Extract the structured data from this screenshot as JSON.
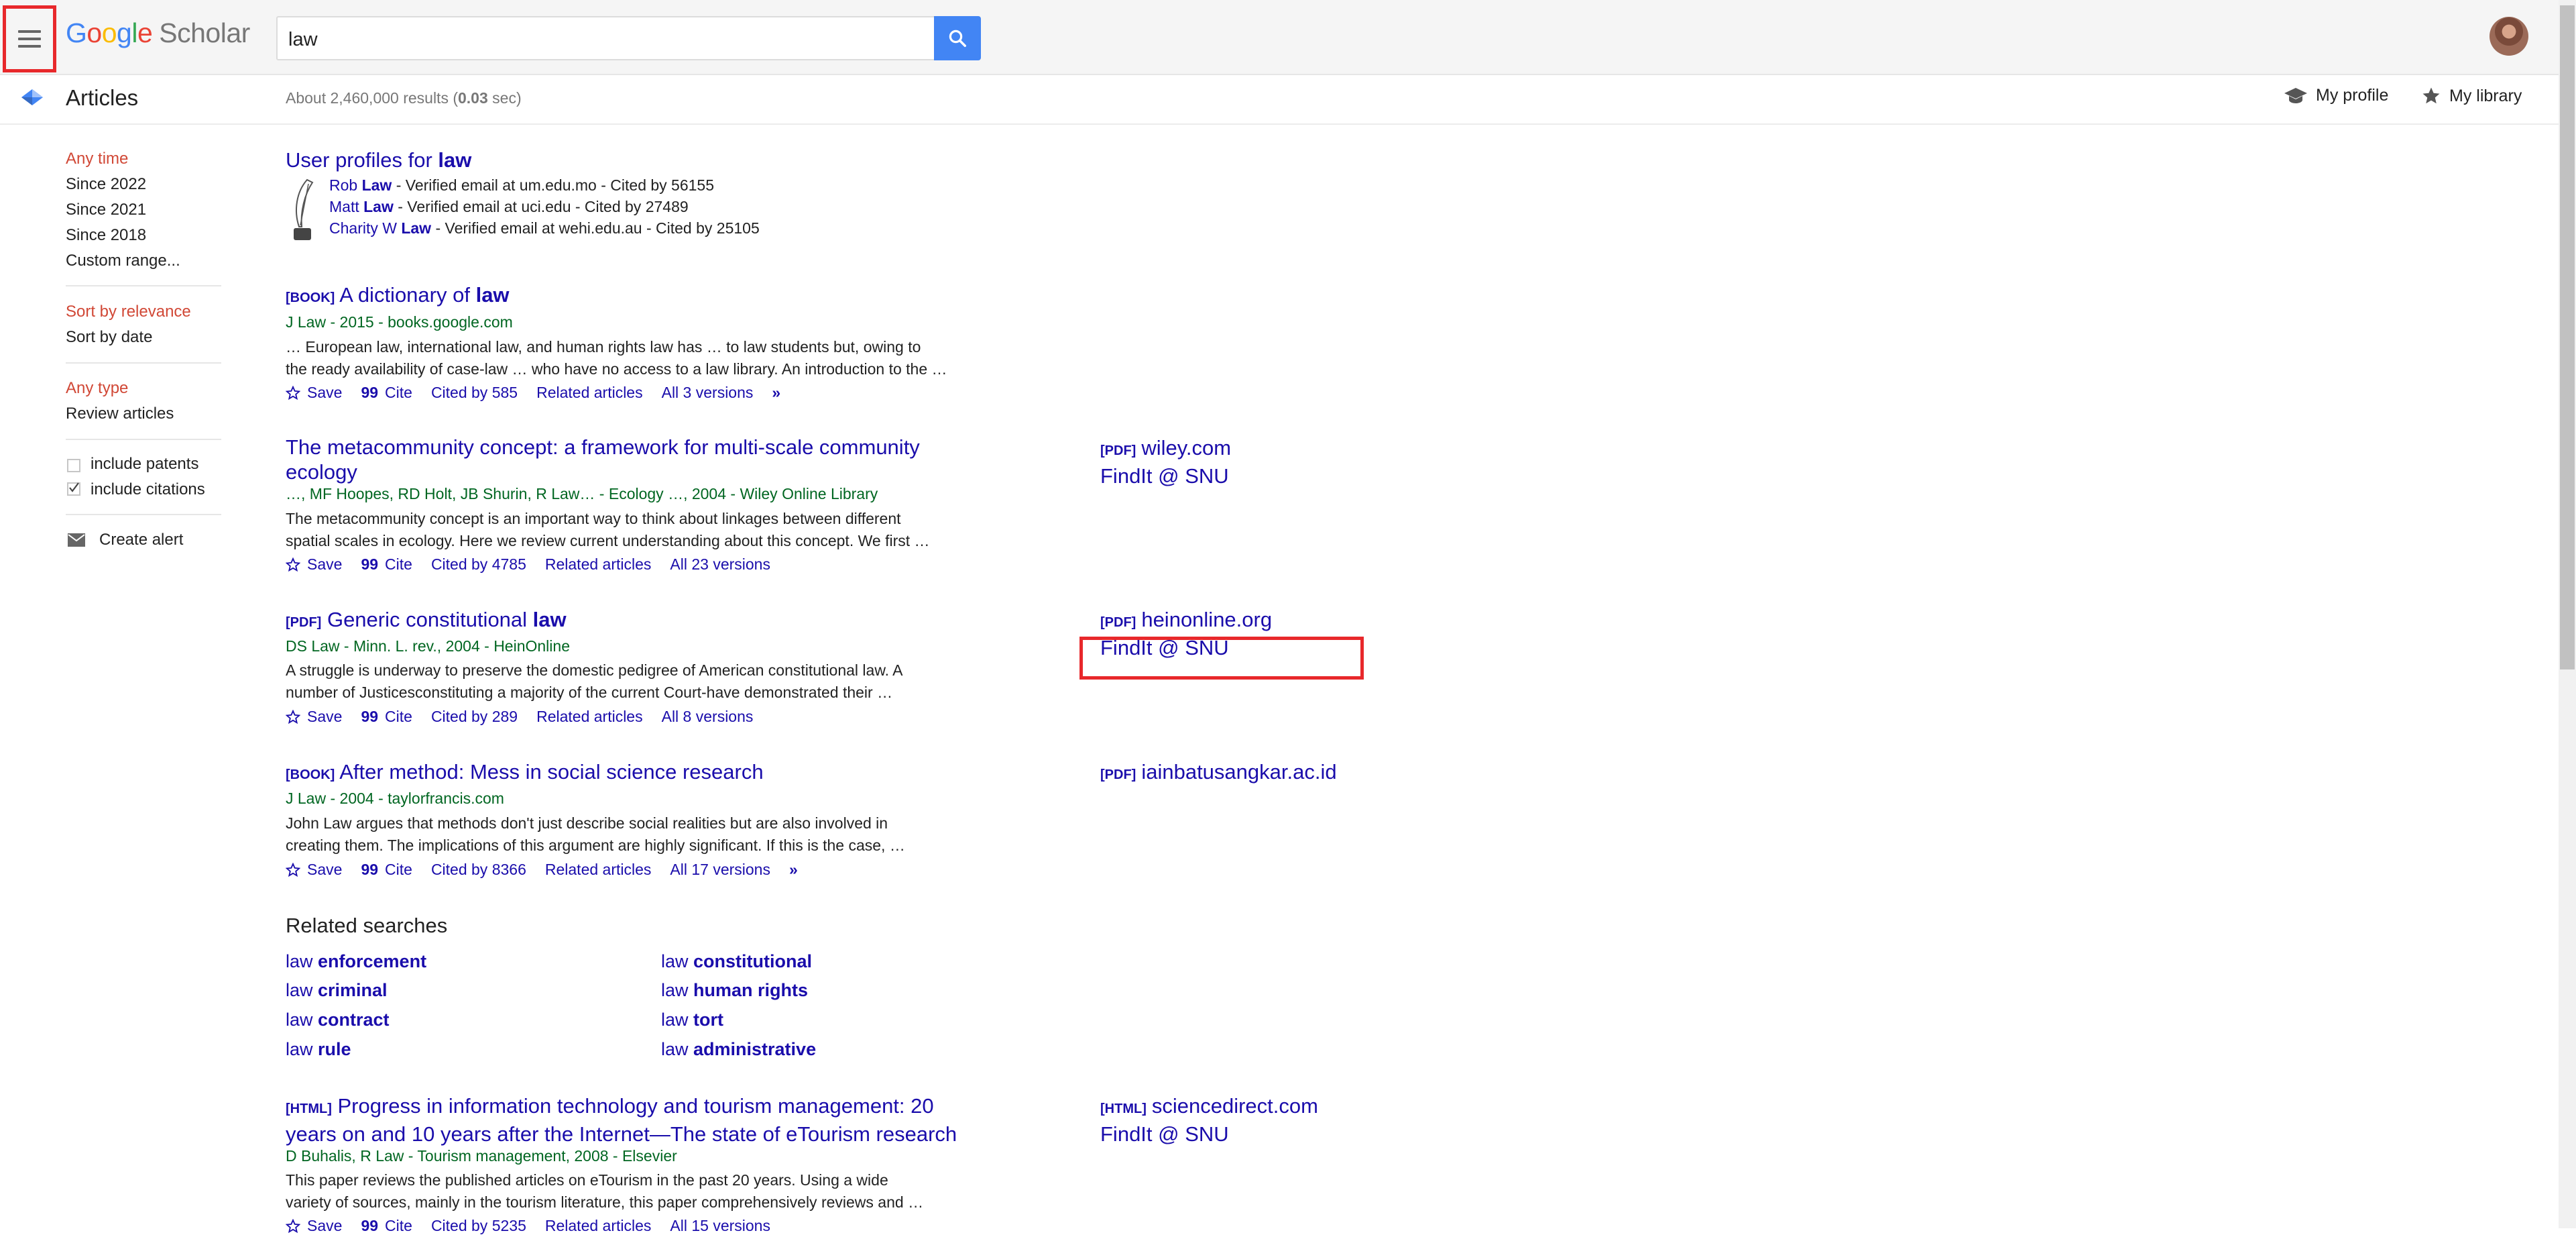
{
  "header": {
    "logo_google": [
      "G",
      "o",
      "o",
      "g",
      "l",
      "e"
    ],
    "logo_scholar": "Scholar",
    "search_value": "law"
  },
  "subheader": {
    "section_label": "Articles",
    "results_prefix": "About 2,460,000 results (",
    "results_time": "0.03",
    "results_suffix": " sec)",
    "my_profile": "My profile",
    "my_library": "My library"
  },
  "sidebar": {
    "time": [
      "Any time",
      "Since 2022",
      "Since 2021",
      "Since 2018",
      "Custom range..."
    ],
    "sort": [
      "Sort by relevance",
      "Sort by date"
    ],
    "type": [
      "Any type",
      "Review articles"
    ],
    "include_patents": "include patents",
    "include_citations": "include citations",
    "create_alert": "Create alert"
  },
  "user_profiles": {
    "title_prefix": "User profiles for ",
    "title_term": "law",
    "profiles": [
      {
        "first": "Rob ",
        "last": "Law",
        "rest": " - Verified email at um.edu.mo - Cited by 56155"
      },
      {
        "first": "Matt ",
        "last": "Law",
        "rest": " - Verified email at uci.edu - Cited by 27489"
      },
      {
        "first": "Charity W ",
        "last": "Law",
        "rest": " - Verified email at wehi.edu.au - Cited by 25105"
      }
    ]
  },
  "results": [
    {
      "tag": "[BOOK]",
      "title_a": "A dictionary of ",
      "title_b": "law",
      "meta": "J Law - 2015 - books.google.com",
      "snippet_1": "… European law, international law, and human rights law has … to law students but, owing to",
      "snippet_2": "the ready availability of case-law … who have no access to a law library. An introduction to the …",
      "save": "Save",
      "cite": "Cite",
      "cited": "Cited by 585",
      "related": "Related articles",
      "versions": "All 3 versions"
    },
    {
      "title_1": "The metacommunity concept: a framework for multi-scale community",
      "title_2": "ecology",
      "meta": "…, MF Hoopes, RD Holt, JB Shurin, R Law… - Ecology …, 2004 - Wiley Online Library",
      "snippet_1": "The metacommunity concept is an important way to think about linkages between different",
      "snippet_2": "spatial scales in ecology. Here we review current understanding about this concept. We first …",
      "save": "Save",
      "cite": "Cite",
      "cited": "Cited by 4785",
      "related": "Related articles",
      "versions": "All 23 versions",
      "side_tag": "[PDF]",
      "side_source": "wiley.com",
      "side_findit": "FindIt @ SNU"
    },
    {
      "tag": "[PDF]",
      "title_a": "Generic constitutional ",
      "title_b": "law",
      "meta": "DS Law - Minn. L. rev., 2004 - HeinOnline",
      "snippet_1": "A struggle is underway to preserve the domestic pedigree of American constitutional law. A",
      "snippet_2": "number of Justicesconstituting a majority of the current Court-have demonstrated their …",
      "save": "Save",
      "cite": "Cite",
      "cited": "Cited by 289",
      "related": "Related articles",
      "versions": "All 8 versions",
      "side_tag": "[PDF]",
      "side_source": "heinonline.org",
      "side_findit": "FindIt @ SNU"
    },
    {
      "tag": "[BOOK]",
      "title": "After method: Mess in social science research",
      "meta": "J Law - 2004 - taylorfrancis.com",
      "snippet_1": "John Law argues that methods don't just describe social realities but are also involved in",
      "snippet_2": "creating them. The implications of this argument are highly significant. If this is the case, …",
      "save": "Save",
      "cite": "Cite",
      "cited": "Cited by 8366",
      "related": "Related articles",
      "versions": "All 17 versions",
      "side_tag": "[PDF]",
      "side_source": "iainbatusangkar.ac.id"
    },
    {
      "tag": "[HTML]",
      "title_1": "Progress in information technology and tourism management: 20",
      "title_2": "years on and 10 years after the Internet—The state of eTourism research",
      "meta": "D Buhalis, R Law - Tourism management, 2008 - Elsevier",
      "snippet_1": "This paper reviews the published articles on eTourism in the past 20 years. Using a wide",
      "snippet_2": "variety of sources, mainly in the tourism literature, this paper comprehensively reviews and …",
      "save": "Save",
      "cite": "Cite",
      "cited": "Cited by 5235",
      "related": "Related articles",
      "versions": "All 15 versions",
      "side_tag": "[HTML]",
      "side_source": "sciencedirect.com",
      "side_findit": "FindIt @ SNU"
    }
  ],
  "related_searches": {
    "heading": "Related searches",
    "items": [
      {
        "a": "law ",
        "b": "enforcement"
      },
      {
        "a": "law ",
        "b": "constitutional"
      },
      {
        "a": "law ",
        "b": "criminal"
      },
      {
        "a": "law ",
        "b": "human rights"
      },
      {
        "a": "law ",
        "b": "contract"
      },
      {
        "a": "law ",
        "b": "tort"
      },
      {
        "a": "law ",
        "b": "rule"
      },
      {
        "a": "law ",
        "b": "administrative"
      }
    ]
  },
  "colors": {
    "link": "#1a0dab",
    "meta_green": "#006621",
    "accent_red": "#d14836",
    "search_blue": "#4285f4",
    "annotation_red": "#e8282b"
  }
}
